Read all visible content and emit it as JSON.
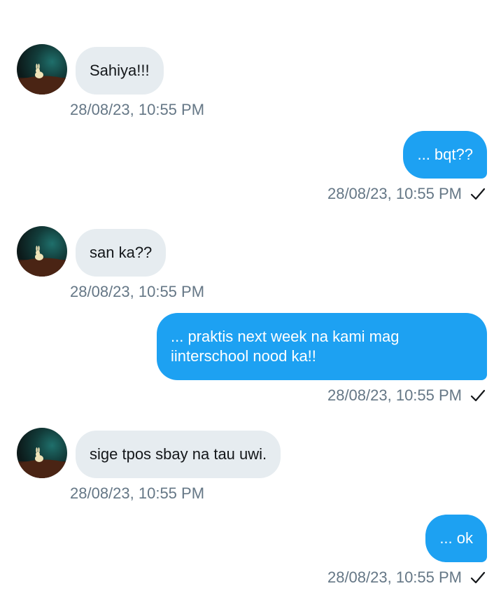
{
  "messages": [
    {
      "direction": "in",
      "text": "Sahiya!!!",
      "timestamp": "28/08/23, 10:55 PM",
      "avatar": "rabbit-avatar"
    },
    {
      "direction": "out",
      "text": "... bqt??",
      "timestamp": "28/08/23, 10:55 PM",
      "status": "sent",
      "status_icon": "checkmark-icon"
    },
    {
      "direction": "in",
      "text": "san ka??",
      "timestamp": "28/08/23, 10:55 PM",
      "avatar": "rabbit-avatar"
    },
    {
      "direction": "out",
      "text": "... praktis next week na kami mag iinterschool nood ka!!",
      "timestamp": "28/08/23, 10:55 PM",
      "status": "sent",
      "status_icon": "checkmark-icon"
    },
    {
      "direction": "in",
      "text": "sige tpos sbay na tau uwi.",
      "timestamp": "28/08/23, 10:55 PM",
      "avatar": "rabbit-avatar"
    },
    {
      "direction": "out",
      "text": "... ok",
      "timestamp": "28/08/23, 10:55 PM",
      "status": "sent",
      "status_icon": "checkmark-icon"
    }
  ],
  "colors": {
    "incoming_bubble": "#e6ecf0",
    "outgoing_bubble": "#1da1f2",
    "timestamp": "#657786"
  }
}
